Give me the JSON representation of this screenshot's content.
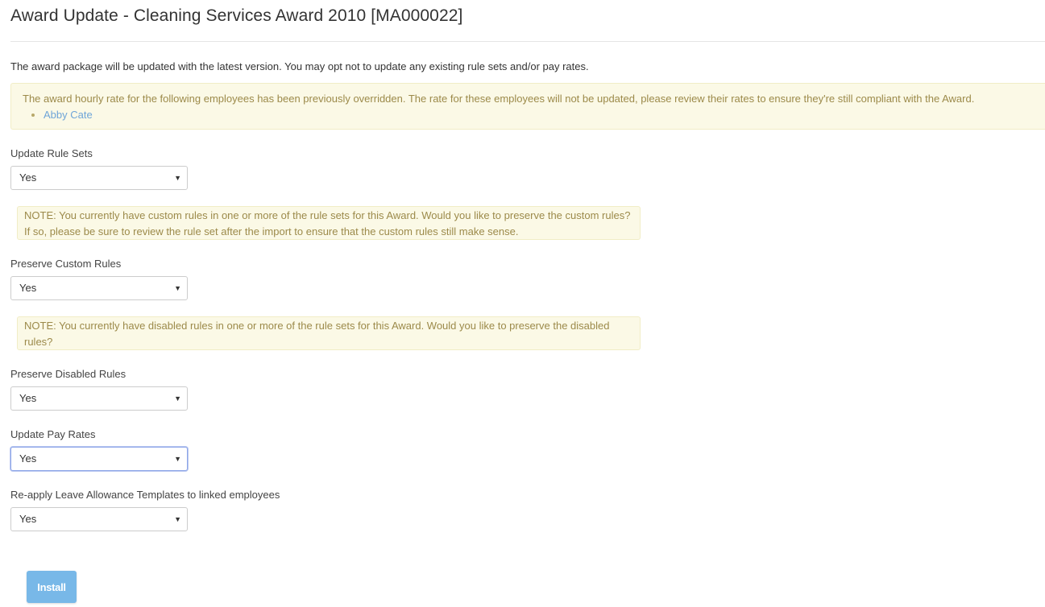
{
  "page": {
    "title": "Award Update - Cleaning Services Award 2010 [MA000022]",
    "intro": "The award package will be updated with the latest version. You may opt not to update any existing rule sets and/or pay rates."
  },
  "override_alert": {
    "message": "The award hourly rate for the following employees has been previously overridden. The rate for these employees will not be updated, please review their rates to ensure they're still compliant with the Award.",
    "employees": [
      "Abby Cate"
    ]
  },
  "fields": {
    "update_rule_sets": {
      "label": "Update Rule Sets",
      "value": "Yes"
    },
    "custom_rules_note": "NOTE: You currently have custom rules in one or more of the rule sets for this Award. Would you like to preserve the custom rules? If so, please be sure to review the rule set after the import to ensure that the custom rules still make sense.",
    "preserve_custom_rules": {
      "label": "Preserve Custom Rules",
      "value": "Yes"
    },
    "disabled_rules_note": "NOTE: You currently have disabled rules in one or more of the rule sets for this Award. Would you like to preserve the disabled rules?",
    "preserve_disabled_rules": {
      "label": "Preserve Disabled Rules",
      "value": "Yes"
    },
    "update_pay_rates": {
      "label": "Update Pay Rates",
      "value": "Yes"
    },
    "reapply_leave_templates": {
      "label": "Re-apply Leave Allowance Templates to linked employees",
      "value": "Yes"
    }
  },
  "actions": {
    "install_label": "Install"
  },
  "icons": {
    "select_caret": "caret-down-icon",
    "bullet": "bullet-dot"
  },
  "colors": {
    "alert_background": "#fbf9e6",
    "alert_text": "#9c8a4a",
    "link": "#6fa5d8",
    "primary_button": "#78b8e8",
    "focus_border": "#8ea6e8"
  }
}
